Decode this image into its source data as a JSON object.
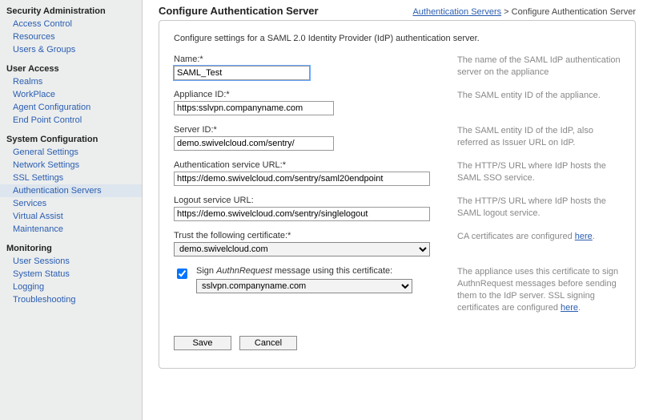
{
  "sidebar": {
    "groups": [
      {
        "title": "Security Administration",
        "items": [
          {
            "label": "Access Control"
          },
          {
            "label": "Resources"
          },
          {
            "label": "Users & Groups"
          }
        ]
      },
      {
        "title": "User Access",
        "items": [
          {
            "label": "Realms"
          },
          {
            "label": "WorkPlace"
          },
          {
            "label": "Agent Configuration"
          },
          {
            "label": "End Point Control"
          }
        ]
      },
      {
        "title": "System Configuration",
        "items": [
          {
            "label": "General Settings"
          },
          {
            "label": "Network Settings"
          },
          {
            "label": "SSL Settings"
          },
          {
            "label": "Authentication Servers",
            "active": true
          },
          {
            "label": "Services"
          },
          {
            "label": "Virtual Assist"
          },
          {
            "label": "Maintenance"
          }
        ]
      },
      {
        "title": "Monitoring",
        "items": [
          {
            "label": "User Sessions"
          },
          {
            "label": "System Status"
          },
          {
            "label": "Logging"
          },
          {
            "label": "Troubleshooting"
          }
        ]
      }
    ]
  },
  "header": {
    "title": "Configure Authentication Server",
    "breadcrumb": {
      "link": "Authentication Servers",
      "sep": ">",
      "current": "Configure Authentication Server"
    }
  },
  "panel": {
    "intro": "Configure settings for a SAML 2.0 Identity Provider (IdP) authentication server.",
    "fields": {
      "name": {
        "label": "Name:*",
        "value": "SAML_Test",
        "help": "The name of the SAML IdP authentication server on the appliance"
      },
      "appliance_id": {
        "label": "Appliance ID:*",
        "value": "https:sslvpn.companyname.com",
        "help": "The SAML entity ID of the appliance."
      },
      "server_id": {
        "label": "Server ID:*",
        "value": "demo.swivelcloud.com/sentry/",
        "help": "The SAML entity ID of the IdP, also referred as Issuer URL on IdP."
      },
      "auth_url": {
        "label": "Authentication service URL:*",
        "value": "https://demo.swivelcloud.com/sentry/saml20endpoint",
        "help": "The HTTP/S URL where IdP hosts the SAML SSO service."
      },
      "logout_url": {
        "label": "Logout service URL:",
        "value": "https://demo.swivelcloud.com/sentry/singlelogout",
        "help": "The HTTP/S URL where IdP hosts the SAML logout service."
      },
      "trust_cert": {
        "label": "Trust the following certificate:*",
        "selected": "demo.swivelcloud.com",
        "help_prefix": "CA certificates are configured ",
        "help_link": "here",
        "help_suffix": "."
      },
      "sign": {
        "checkbox_label_prefix": "Sign ",
        "checkbox_label_italic": "AuthnRequest",
        "checkbox_label_suffix": " message using this certificate:",
        "selected": "sslvpn.companyname.com",
        "help_prefix": "The appliance uses this certificate to sign AuthnRequest messages before sending them to the IdP server. SSL signing certificates are configured ",
        "help_link": "here",
        "help_suffix": "."
      }
    },
    "buttons": {
      "save": "Save",
      "cancel": "Cancel"
    }
  }
}
